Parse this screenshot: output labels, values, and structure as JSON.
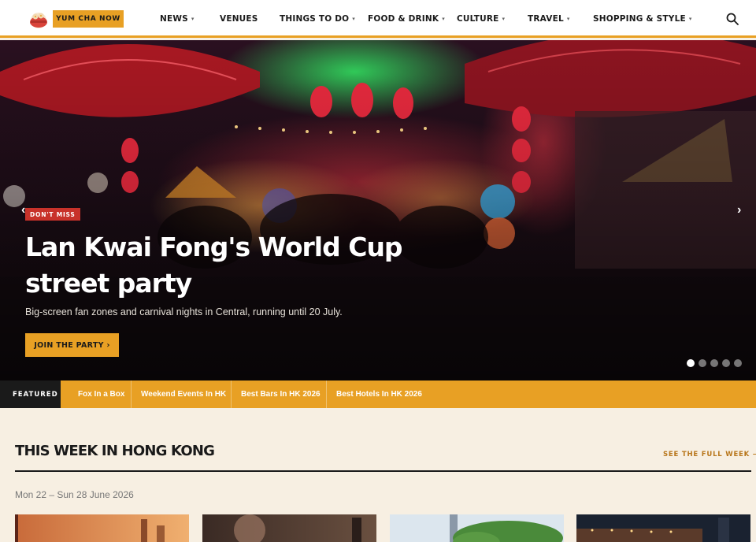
{
  "header": {
    "brand_label": "YUM CHA NOW",
    "logo_icon": "dim-sum-basket-icon",
    "nav": [
      {
        "label": "NEWS",
        "has_dropdown": true
      },
      {
        "label": "VENUES",
        "has_dropdown": false
      },
      {
        "label": "THINGS TO DO",
        "has_dropdown": true
      },
      {
        "label": "FOOD & DRINK",
        "has_dropdown": true
      },
      {
        "label": "CULTURE",
        "has_dropdown": true
      },
      {
        "label": "TRAVEL",
        "has_dropdown": true
      },
      {
        "label": "SHOPPING & STYLE",
        "has_dropdown": true
      }
    ],
    "caret": "▾",
    "search_icon": "search-icon"
  },
  "hero": {
    "badge": "DON'T MISS",
    "title": "Lan Kwai Fong's World Cup street party",
    "subtitle": "Big-screen fan zones and carnival nights in Central, running until 20 July.",
    "cta_label": "JOIN THE PARTY ›",
    "prev_arrow": "‹",
    "next_arrow": "›",
    "slide_count": 5,
    "active_slide": 1
  },
  "featured": {
    "label": "FEATURED",
    "links": [
      "Fox In a Box",
      "Weekend Events In HK",
      "Best Bars In HK 2026",
      "Best Hotels In HK 2026"
    ]
  },
  "this_week": {
    "title": "THIS WEEK IN HONG KONG",
    "see_all": "SEE THE FULL WEEK →",
    "date_range": "Mon 22 – Sun 28 June 2026"
  },
  "colors": {
    "accent": "#e8a024",
    "badge_red": "#c8322a",
    "page_bg": "#f7efe2",
    "dark": "#1a1a1a"
  }
}
